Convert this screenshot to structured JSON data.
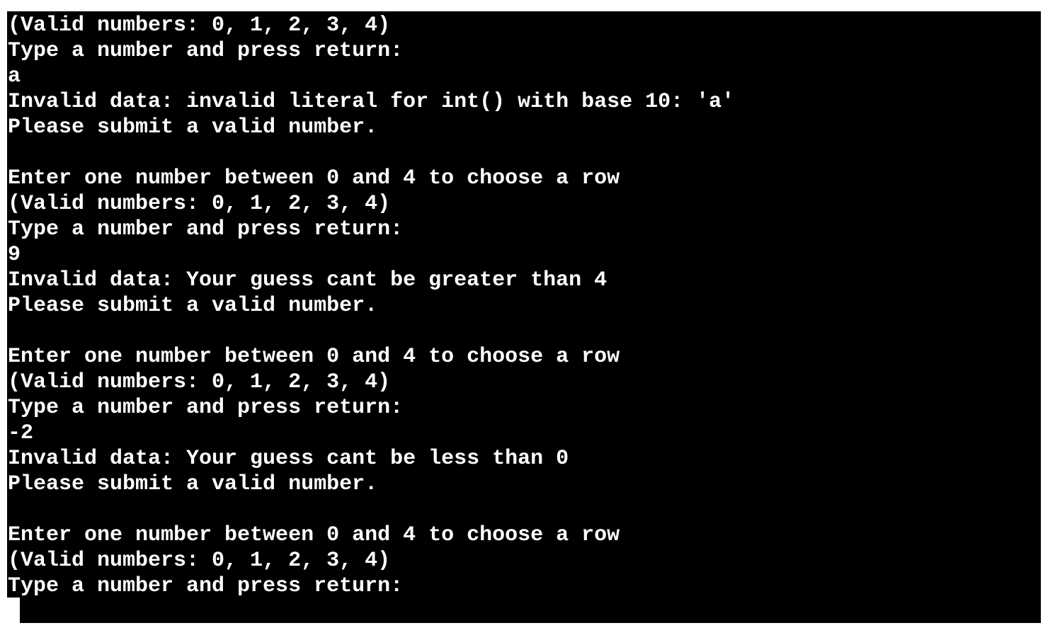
{
  "terminal": {
    "background": "#000000",
    "foreground": "#ffffff",
    "lines": [
      "(Valid numbers: 0, 1, 2, 3, 4)",
      "Type a number and press return:",
      "a",
      "Invalid data: invalid literal for int() with base 10: 'a'",
      "Please submit a valid number.",
      "",
      "Enter one number between 0 and 4 to choose a row",
      "(Valid numbers: 0, 1, 2, 3, 4)",
      "Type a number and press return:",
      "9",
      "Invalid data: Your guess cant be greater than 4",
      "Please submit a valid number.",
      "",
      "Enter one number between 0 and 4 to choose a row",
      "(Valid numbers: 0, 1, 2, 3, 4)",
      "Type a number and press return:",
      "-2",
      "Invalid data: Your guess cant be less than 0",
      "Please submit a valid number.",
      "",
      "Enter one number between 0 and 4 to choose a row",
      "(Valid numbers: 0, 1, 2, 3, 4)",
      "Type a number and press return:"
    ]
  }
}
